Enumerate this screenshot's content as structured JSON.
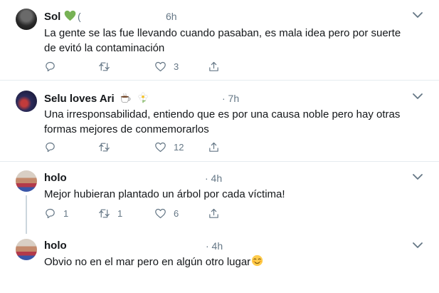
{
  "replies": [
    {
      "name": "Sol",
      "handle": "(",
      "time": "6h",
      "text": "La gente se las fue llevando cuando pasaban, es mala idea pero por suerte de evitó la contaminación",
      "reply_count": "",
      "retweet_count": "",
      "like_count": "3"
    },
    {
      "name": "Selu loves Ari",
      "time": "· 7h",
      "text": "Una irresponsabilidad, entiendo que es por una causa noble pero hay otras formas mejores de conmemorarlos",
      "reply_count": "",
      "retweet_count": "",
      "like_count": "12"
    },
    {
      "name": "holo",
      "time": "· 4h",
      "text": "Mejor hubieran plantado un árbol por cada víctima!",
      "reply_count": "1",
      "retweet_count": "1",
      "like_count": "6"
    },
    {
      "name": "holo",
      "time": "· 4h",
      "text": "Obvio no en el mar pero en algún otro lugar",
      "reply_count": "",
      "retweet_count": "",
      "like_count": ""
    }
  ],
  "colors": {
    "accent": "#1da1f2",
    "secondary_text": "#657786",
    "icon": "#657786",
    "divider": "#e6ecf0",
    "heart_emoji": "#77b255"
  },
  "icons": [
    "reply-icon",
    "retweet-icon",
    "like-icon",
    "share-icon",
    "chevron-down-icon",
    "green-heart-emoji",
    "coffee-emoji",
    "flower-emoji",
    "smiling-face-emoji"
  ]
}
